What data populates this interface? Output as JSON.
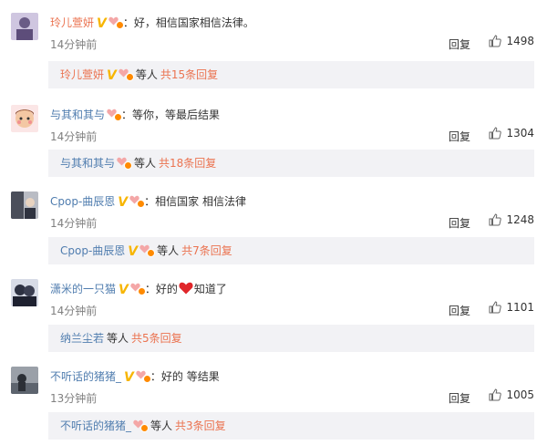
{
  "comments": [
    {
      "username": "玲儿萱妍",
      "verified": "V",
      "separator": "：",
      "text": "好，相信国家相信法律。",
      "time": "14分钟前",
      "reply_label": "回复",
      "likes": "1498",
      "sub": {
        "username": "玲儿萱妍",
        "others": "等人",
        "total": "共15条回复"
      }
    },
    {
      "username": "与其和其与",
      "verified": "",
      "separator": "：",
      "text": "等你，等最后结果",
      "time": "14分钟前",
      "reply_label": "回复",
      "likes": "1304",
      "sub": {
        "username": "与其和其与",
        "others": "等人",
        "total": "共18条回复"
      }
    },
    {
      "username": "Cpop-曲辰恩",
      "verified": "V",
      "separator": "：",
      "text": "相信国家 相信法律",
      "time": "14分钟前",
      "reply_label": "回复",
      "likes": "1248",
      "sub": {
        "username": "Cpop-曲辰恩",
        "others": "等人",
        "total": "共7条回复"
      }
    },
    {
      "username": "潇米的一只猫",
      "verified": "V",
      "separator": "：",
      "text_before": "好的",
      "text_after": "知道了",
      "time": "14分钟前",
      "reply_label": "回复",
      "likes": "1101",
      "sub": {
        "username": "纳兰尘若",
        "others": "等人",
        "total": "共5条回复"
      }
    },
    {
      "username": "不听话的猪猪_",
      "verified": "V",
      "separator": "：",
      "text": "好的 等结果",
      "time": "13分钟前",
      "reply_label": "回复",
      "likes": "1005",
      "sub": {
        "username": "不听话的猪猪_",
        "others": "等人",
        "total": "共3条回复"
      }
    }
  ],
  "colors": {
    "username_orange": "#eb7350",
    "username_blue": "#507daf",
    "verified_gold": "#f7b500",
    "subbar_bg": "#f2f2f5",
    "time_gray": "#808080"
  },
  "icons": {
    "verified": "v-badge-icon",
    "medal": "fan-medal-icon",
    "like": "thumbs-up-icon",
    "emoji": "red-heart-emoji"
  }
}
